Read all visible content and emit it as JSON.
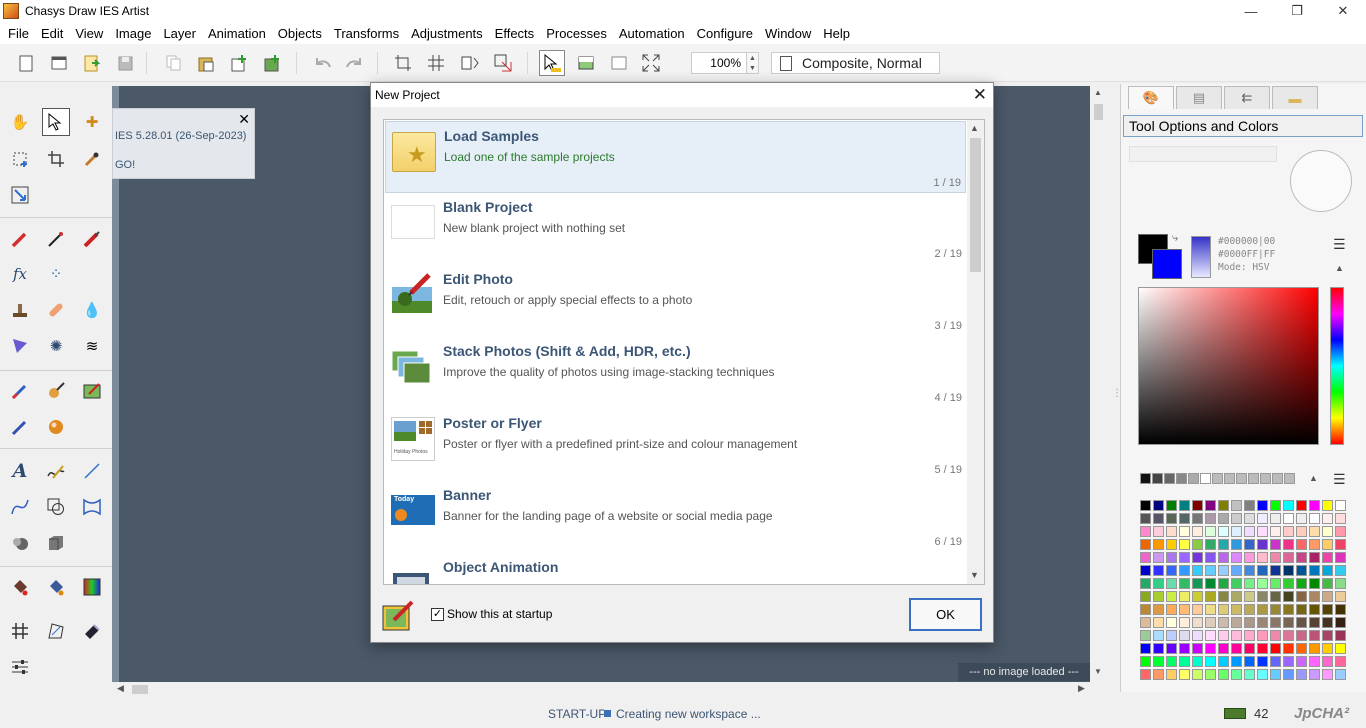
{
  "window": {
    "title": "Chasys Draw IES Artist",
    "controls": [
      "—",
      "❐",
      "✕"
    ]
  },
  "menu": [
    "File",
    "Edit",
    "View",
    "Image",
    "Layer",
    "Animation",
    "Objects",
    "Transforms",
    "Adjustments",
    "Effects",
    "Processes",
    "Automation",
    "Configure",
    "Window",
    "Help"
  ],
  "toolbar": {
    "zoom": "100%",
    "blend_mode": "Composite, Normal"
  },
  "info_panel": {
    "version": "IES 5.28.01 (26-Sep-2023)",
    "go": "GO!",
    "close": "✕"
  },
  "canvas": {
    "status": "--- no image loaded ---"
  },
  "right_panel": {
    "header": "Tool Options and Colors",
    "fg_hex": "#000000|00",
    "bg_hex": "#0000FF|FF",
    "mode": "Mode: HSV"
  },
  "dialog": {
    "title": "New Project",
    "close": "✕",
    "items": [
      {
        "title": "Load Samples",
        "desc": "Load one of the sample projects",
        "count": "1 / 19"
      },
      {
        "title": "Blank Project",
        "desc": "New blank project with nothing set",
        "count": "2 / 19"
      },
      {
        "title": "Edit Photo",
        "desc": "Edit, retouch or apply special effects to a photo",
        "count": "3 / 19"
      },
      {
        "title": "Stack Photos (Shift & Add, HDR, etc.)",
        "desc": "Improve the quality of photos using image-stacking techniques",
        "count": "4 / 19"
      },
      {
        "title": "Poster or Flyer",
        "desc": "Poster or flyer with a predefined print-size and colour management",
        "count": "5 / 19"
      },
      {
        "title": "Banner",
        "desc": "Banner for the landing page of a website or social media page",
        "count": "6 / 19"
      },
      {
        "title": "Object Animation",
        "desc": "",
        "count": ""
      }
    ],
    "show_at_startup": "Show this at startup",
    "ok": "OK",
    "thumb_labels": {
      "poster": "Holiday Photos",
      "banner": "Today"
    }
  },
  "status": {
    "startup": "START-UP",
    "message": "Creating new workspace ...",
    "memory": "42",
    "brand": "JpCHA²"
  }
}
